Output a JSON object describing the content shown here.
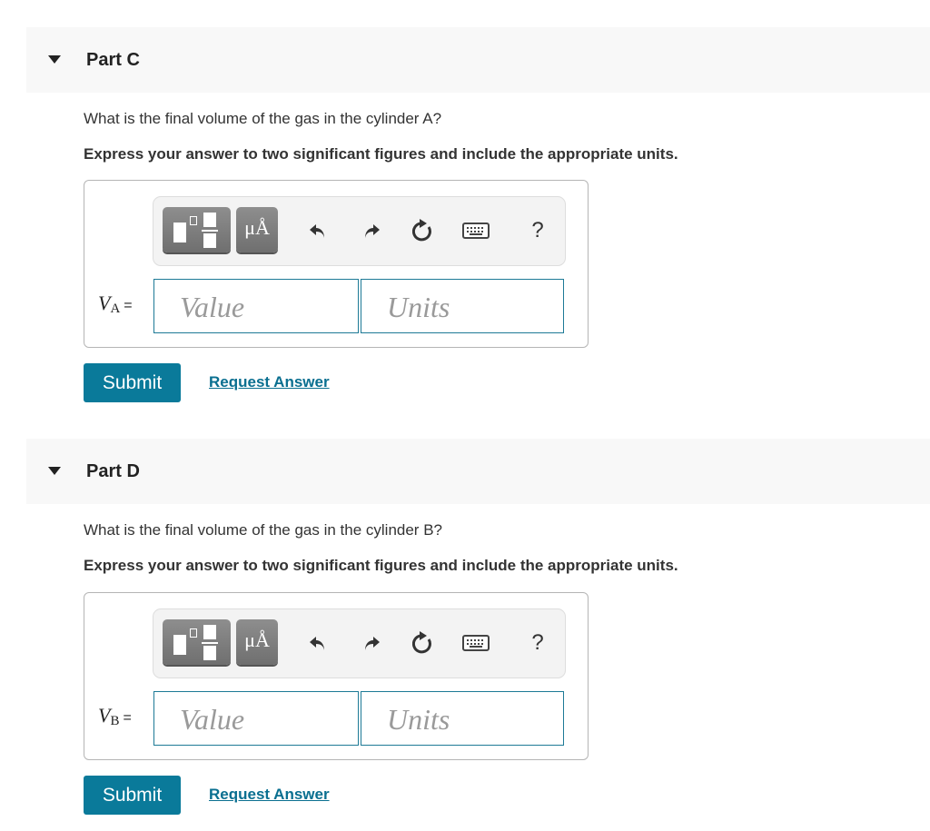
{
  "parts": [
    {
      "title": "Part C",
      "question": "What is the final volume of the gas in the cylinder A?",
      "instruction": "Express your answer to two significant figures and include the appropriate units.",
      "variable": {
        "symbol": "V",
        "subscript": "A",
        "equals": "="
      },
      "value_field": {
        "placeholder": "Value",
        "value": ""
      },
      "units_field": {
        "placeholder": "Units",
        "value": ""
      },
      "toolbar": {
        "templates_icon": "templates-icon",
        "symbols_label": "μÅ",
        "undo_icon": "undo-icon",
        "redo_icon": "redo-icon",
        "reset_icon": "reset-icon",
        "keyboard_icon": "keyboard-icon",
        "help_label": "?"
      },
      "submit_label": "Submit",
      "request_answer_label": "Request Answer"
    },
    {
      "title": "Part D",
      "question": "What is the final volume of the gas in the cylinder B?",
      "instruction": "Express your answer to two significant figures and include the appropriate units.",
      "variable": {
        "symbol": "V",
        "subscript": "B",
        "equals": "="
      },
      "value_field": {
        "placeholder": "Value",
        "value": ""
      },
      "units_field": {
        "placeholder": "Units",
        "value": ""
      },
      "toolbar": {
        "templates_icon": "templates-icon",
        "symbols_label": "μÅ",
        "undo_icon": "undo-icon",
        "redo_icon": "redo-icon",
        "reset_icon": "reset-icon",
        "keyboard_icon": "keyboard-icon",
        "help_label": "?"
      },
      "submit_label": "Submit",
      "request_answer_label": "Request Answer"
    }
  ],
  "colors": {
    "accent": "#0a7a9a",
    "link": "#0a6f90",
    "header_bg": "#f8f8f8",
    "field_border": "#1d7a96",
    "toolbar_bg": "#f3f3f3"
  }
}
